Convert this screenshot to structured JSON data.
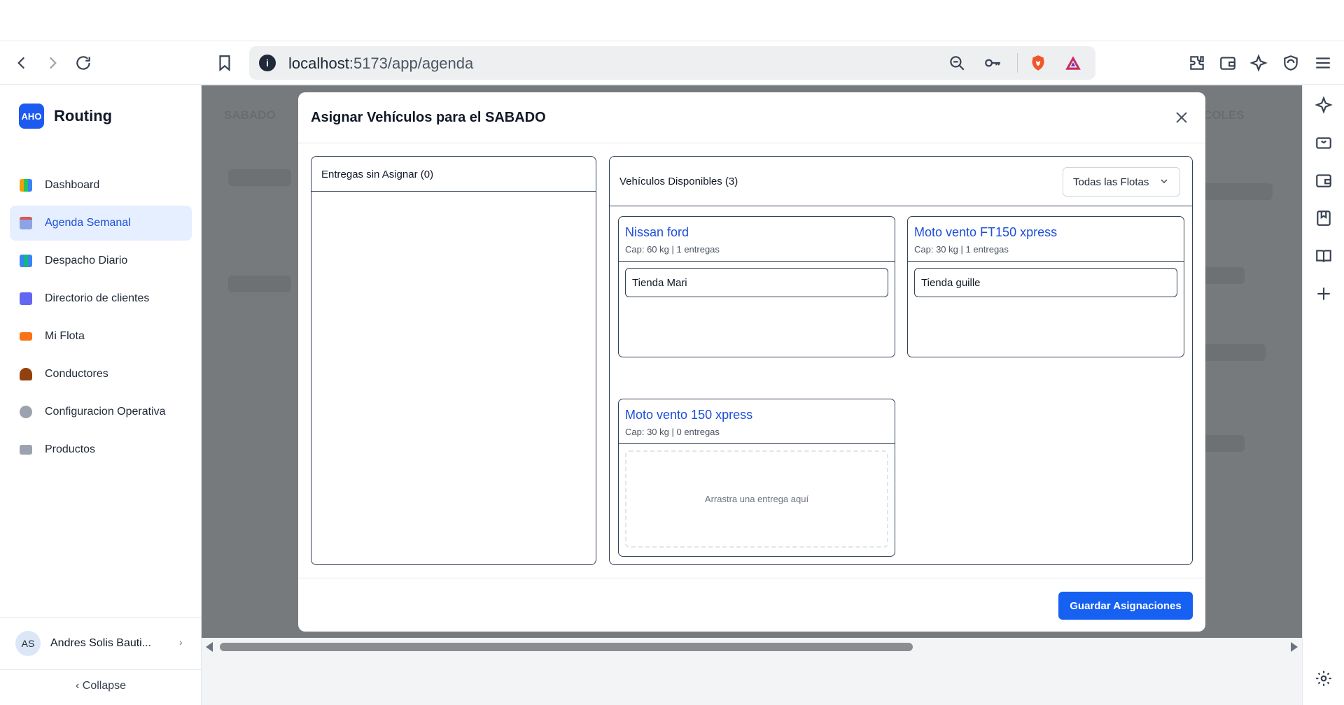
{
  "browser": {
    "url_host": "localhost",
    "url_path": ":5173/app/agenda",
    "info_icon": "info-icon"
  },
  "sidebar": {
    "brand_logo": "AHO",
    "brand_name": "Routing",
    "items": [
      {
        "label": "Dashboard",
        "color": "#f59e0b"
      },
      {
        "label": "Agenda Semanal",
        "color": "#6d8bd8"
      },
      {
        "label": "Despacho Diario",
        "color": "#3b82f6"
      },
      {
        "label": "Directorio de clientes",
        "color": "#6366f1"
      },
      {
        "label": "Mi Flota",
        "color": "#f97316"
      },
      {
        "label": "Conductores",
        "color": "#92400e"
      },
      {
        "label": "Configuracion Operativa",
        "color": "#9ca3af"
      },
      {
        "label": "Productos",
        "color": "#9ca3af"
      }
    ],
    "active_item": "Agenda Semanal",
    "user_initials": "AS",
    "user_name": "Andres Solis Bauti...",
    "user_chevron": "›",
    "collapse_label": "‹  Collapse"
  },
  "background": {
    "left_day": "SABADO",
    "right_day": "COLES"
  },
  "modal": {
    "title": "Asignar Vehículos para el SABADO",
    "unassigned_title": "Entregas sin Asignar (0)",
    "vehicles_title": "Vehículos Disponibles (3)",
    "fleet_filter": "Todas las Flotas",
    "vehicles": [
      {
        "name": "Nissan ford",
        "capacity": "Cap: 60 kg | 1 entregas",
        "deliveries": [
          "Tienda Mari"
        ]
      },
      {
        "name": "Moto vento FT150 xpress",
        "capacity": "Cap: 30 kg | 1 entregas",
        "deliveries": [
          "Tienda guille"
        ]
      },
      {
        "name": "Moto vento 150 xpress",
        "capacity": "Cap: 30 kg | 0 entregas",
        "deliveries": []
      }
    ],
    "drop_hint": "Arrastra una entrega aquí",
    "save_label": "Guardar Asignaciones"
  },
  "colors": {
    "accent": "#1660f2",
    "link": "#1d4ed8",
    "backdrop": "#777a7d"
  }
}
